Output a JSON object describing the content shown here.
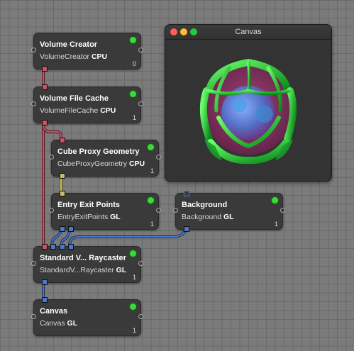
{
  "nodes": {
    "volume_creator": {
      "title": "Volume Creator",
      "identifier": "VolumeCreator",
      "platform": "CPU",
      "count": "0"
    },
    "volume_file_cache": {
      "title": "Volume File Cache",
      "identifier": "VolumeFileCache",
      "platform": "CPU",
      "count": "1"
    },
    "cube_proxy": {
      "title": "Cube Proxy Geometry",
      "identifier": "CubeProxyGeometry",
      "platform": "CPU",
      "count": "1"
    },
    "entry_exit": {
      "title": "Entry Exit Points",
      "identifier": "EntryExitPoints",
      "platform": "GL",
      "count": "1"
    },
    "background": {
      "title": "Background",
      "identifier": "Background",
      "platform": "GL",
      "count": "1"
    },
    "raycaster": {
      "title": "Standard V... Raycaster",
      "identifier": "StandardV...Raycaster",
      "platform": "GL",
      "count": "1"
    },
    "canvas": {
      "title": "Canvas",
      "identifier": "Canvas",
      "platform": "GL",
      "count": "1"
    }
  },
  "canvas_window": {
    "title": "Canvas"
  },
  "colors": {
    "volume_port": "#c0566a",
    "mesh_port": "#c8c060",
    "image_port": "#4a78c8",
    "status_led": "#33dd33",
    "close": "#ff5f57",
    "minimize": "#febc2e",
    "zoom": "#28c840"
  },
  "icons": [
    "close-icon",
    "minimize-icon",
    "zoom-icon",
    "status-led-icon"
  ]
}
